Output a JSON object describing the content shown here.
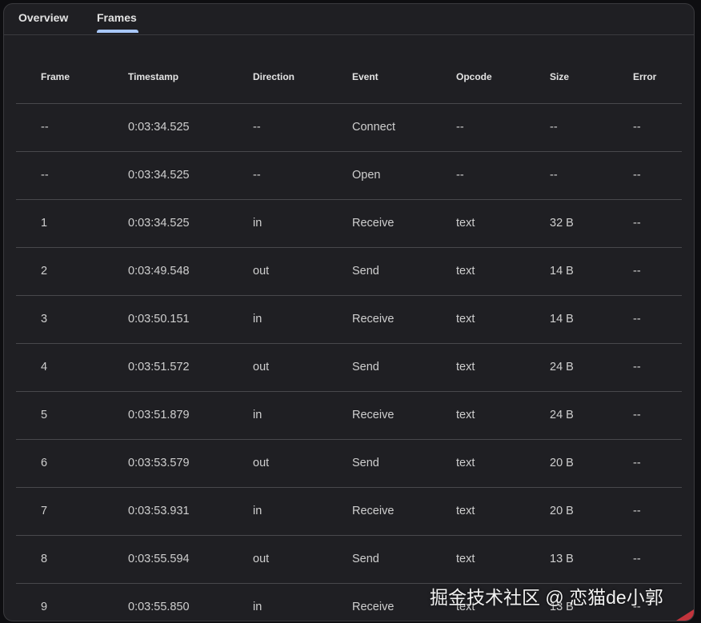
{
  "tabs": [
    {
      "label": "Overview",
      "active": false
    },
    {
      "label": "Frames",
      "active": true
    }
  ],
  "accent_color": "#a8c7fa",
  "table": {
    "columns": [
      "Frame",
      "Timestamp",
      "Direction",
      "Event",
      "Opcode",
      "Size",
      "Error"
    ],
    "rows": [
      [
        "--",
        "0:03:34.525",
        "--",
        "Connect",
        "--",
        "--",
        "--"
      ],
      [
        "--",
        "0:03:34.525",
        "--",
        "Open",
        "--",
        "--",
        "--"
      ],
      [
        "1",
        "0:03:34.525",
        "in",
        "Receive",
        "text",
        "32 B",
        "--"
      ],
      [
        "2",
        "0:03:49.548",
        "out",
        "Send",
        "text",
        "14 B",
        "--"
      ],
      [
        "3",
        "0:03:50.151",
        "in",
        "Receive",
        "text",
        "14 B",
        "--"
      ],
      [
        "4",
        "0:03:51.572",
        "out",
        "Send",
        "text",
        "24 B",
        "--"
      ],
      [
        "5",
        "0:03:51.879",
        "in",
        "Receive",
        "text",
        "24 B",
        "--"
      ],
      [
        "6",
        "0:03:53.579",
        "out",
        "Send",
        "text",
        "20 B",
        "--"
      ],
      [
        "7",
        "0:03:53.931",
        "in",
        "Receive",
        "text",
        "20 B",
        "--"
      ],
      [
        "8",
        "0:03:55.594",
        "out",
        "Send",
        "text",
        "13 B",
        "--"
      ],
      [
        "9",
        "0:03:55.850",
        "in",
        "Receive",
        "text",
        "13 B",
        "--"
      ]
    ]
  },
  "watermark": "掘金技术社区 @ 恋猫de小郭"
}
